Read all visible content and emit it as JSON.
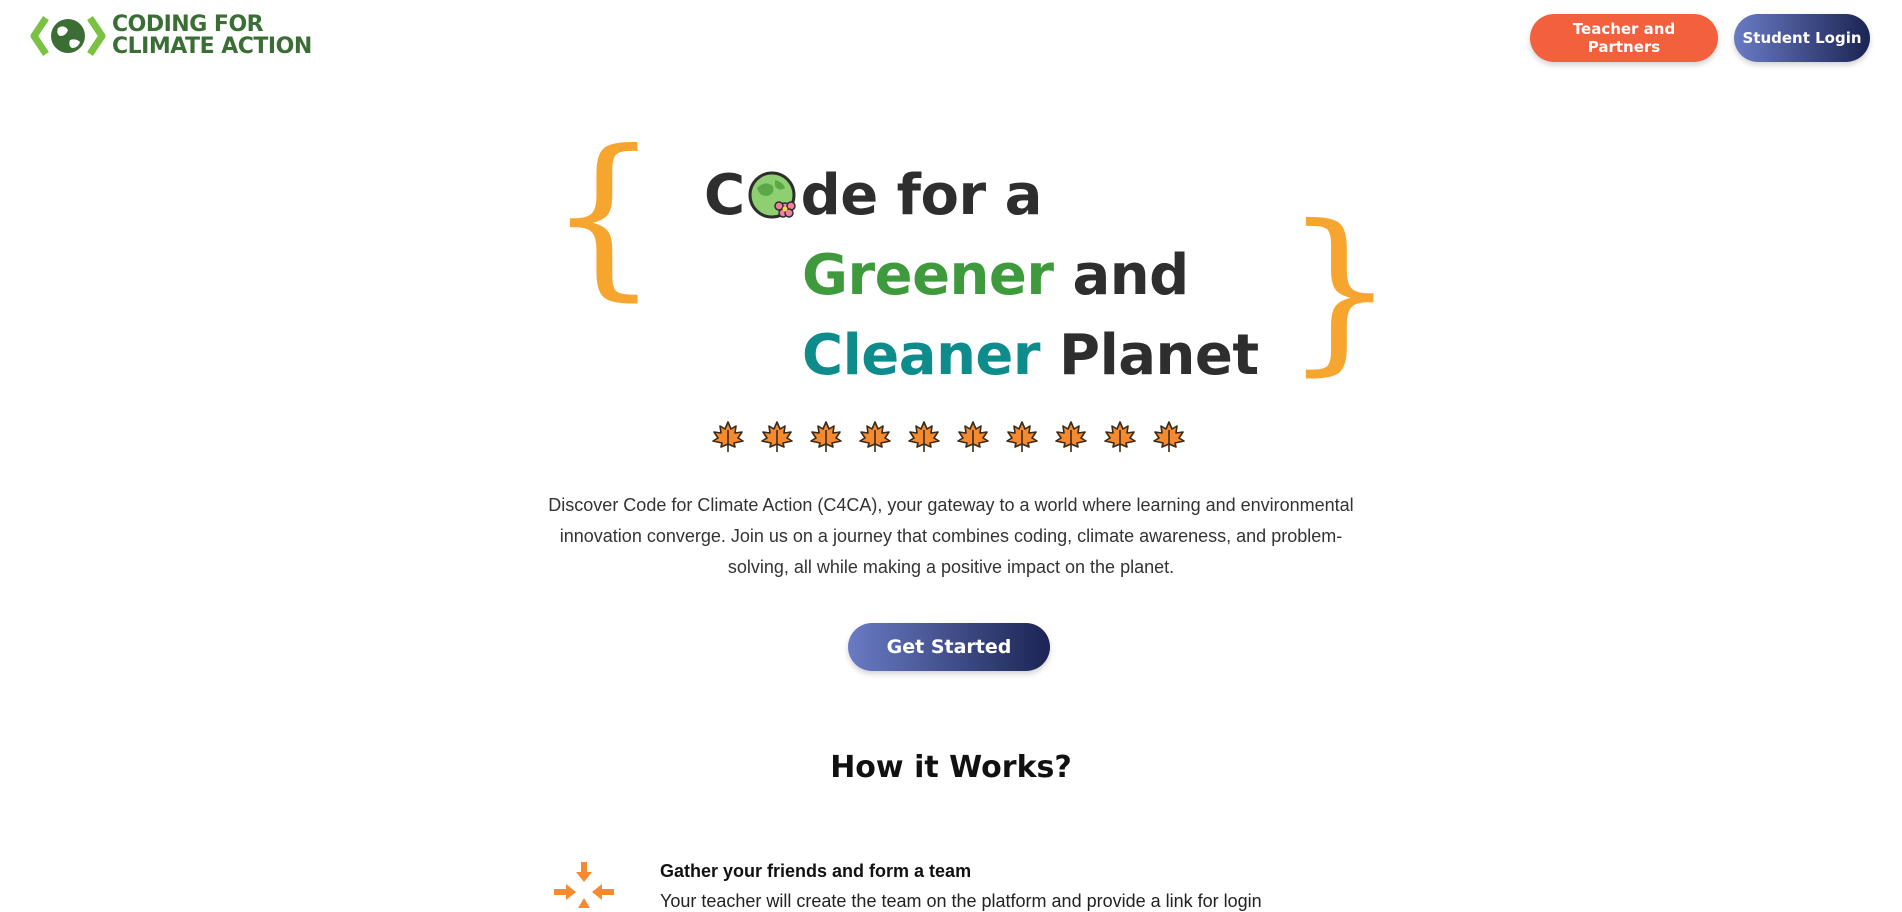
{
  "header": {
    "logo_line1": "CODING FOR",
    "logo_line2": "CLIMATE ACTION",
    "partners_label": "Teacher and Partners",
    "student_label": "Student Login"
  },
  "hero": {
    "line1_start": "C",
    "line1_end": "de for a",
    "line2_highlight": "Greener",
    "line2_rest": " and",
    "line3_highlight": "Cleaner",
    "line3_rest": " Planet",
    "leaf_count": 10
  },
  "description": "Discover Code for Climate Action (C4CA), your gateway to a world where learning and environmental innovation converge. Join us on a journey that combines coding, climate awareness, and problem-solving, all while making a positive impact on the planet.",
  "cta_label": "Get Started",
  "how_it_works": {
    "heading": "How it Works?",
    "steps": [
      {
        "title": "Gather your friends and form a team",
        "text": "Your teacher will create the team on the platform and provide a link for login"
      }
    ]
  },
  "colors": {
    "brand_green": "#3b6e35",
    "accent_orange": "#f2603e",
    "brace": "#f6a62e",
    "green": "#3f9a3e",
    "teal": "#0e8c8c",
    "navy_gradient_end": "#1b2453"
  }
}
